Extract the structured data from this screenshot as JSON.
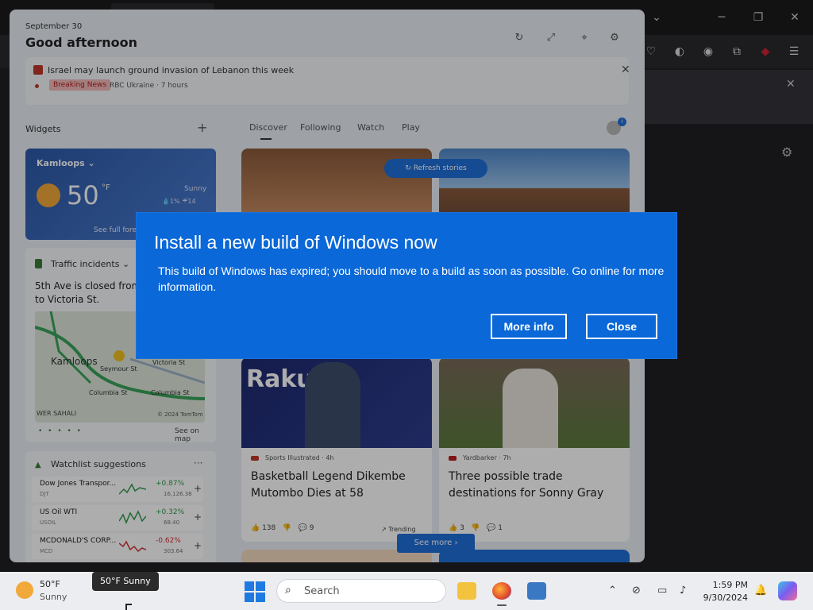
{
  "browser": {
    "window_controls": {
      "minimize": "─",
      "restore": "❐",
      "close": "✕"
    },
    "toolbar_icons": [
      "pocket-icon",
      "vpn-icon",
      "account-icon",
      "extensions-icon",
      "ublock-icon",
      "menu-icon"
    ]
  },
  "panel": {
    "date": "September 30",
    "greeting": "Good afternoon",
    "breaking": {
      "headline": "Israel may launch ground invasion of Lebanon this week",
      "badge": "Breaking News",
      "source": "RBC Ukraine · 7 hours"
    },
    "widgets_label": "Widgets",
    "tabs": [
      "Discover",
      "Following",
      "Watch",
      "Play"
    ],
    "refresh_label": "Refresh stories",
    "see_more": "See more",
    "weather": {
      "city": "Kamloops",
      "temp": "50",
      "unit": "°F",
      "condition": "Sunny",
      "stats": "💧1%  ☔14",
      "link": "See full forecast"
    },
    "traffic": {
      "title": "Traffic incidents",
      "description": "5th Ave is closed from to Victoria St.",
      "map_city": "Kamloops",
      "map_streets": [
        "Seymour St",
        "Victoria St",
        "Columbia St",
        "Columbia St"
      ],
      "map_bottom": "WER SAHALI",
      "copyright": "© 2024 TomTom",
      "see_map": "See on map"
    },
    "watchlist": {
      "title": "Watchlist suggestions",
      "stocks": [
        {
          "name": "Dow Jones Transpor...",
          "ticker": "DJT",
          "change": "+0.87%",
          "value": "16,126.38",
          "up": true
        },
        {
          "name": "US Oil WTI",
          "ticker": "USOIL",
          "change": "+0.32%",
          "value": "68.40",
          "up": true
        },
        {
          "name": "MCDONALD'S CORP...",
          "ticker": "MCD",
          "change": "-0.62%",
          "value": "303.64",
          "up": false
        }
      ]
    },
    "cards": [
      {
        "source": "Sports Illustrated · 4h",
        "title": "Basketball Legend Dikembe Mutombo Dies at 58",
        "likes": "138",
        "comments": "9",
        "tag": "Trending",
        "brand": "Rakuten"
      },
      {
        "source": "Yardbarker · 7h",
        "title": "Three possible trade destinations for Sonny Gray",
        "likes": "3",
        "comments": "1"
      }
    ]
  },
  "dialog": {
    "title": "Install a new build of Windows now",
    "message": "This build of Windows has expired; you should move to a build as soon as possible. Go online for more information.",
    "more_info": "More info",
    "close": "Close",
    "color": "#0a68d8"
  },
  "taskbar": {
    "weather_temp": "50°F",
    "weather_cond": "Sunny",
    "tooltip": "50°F Sunny",
    "search_placeholder": "Search",
    "time": "1:59 PM",
    "date": "9/30/2024"
  }
}
